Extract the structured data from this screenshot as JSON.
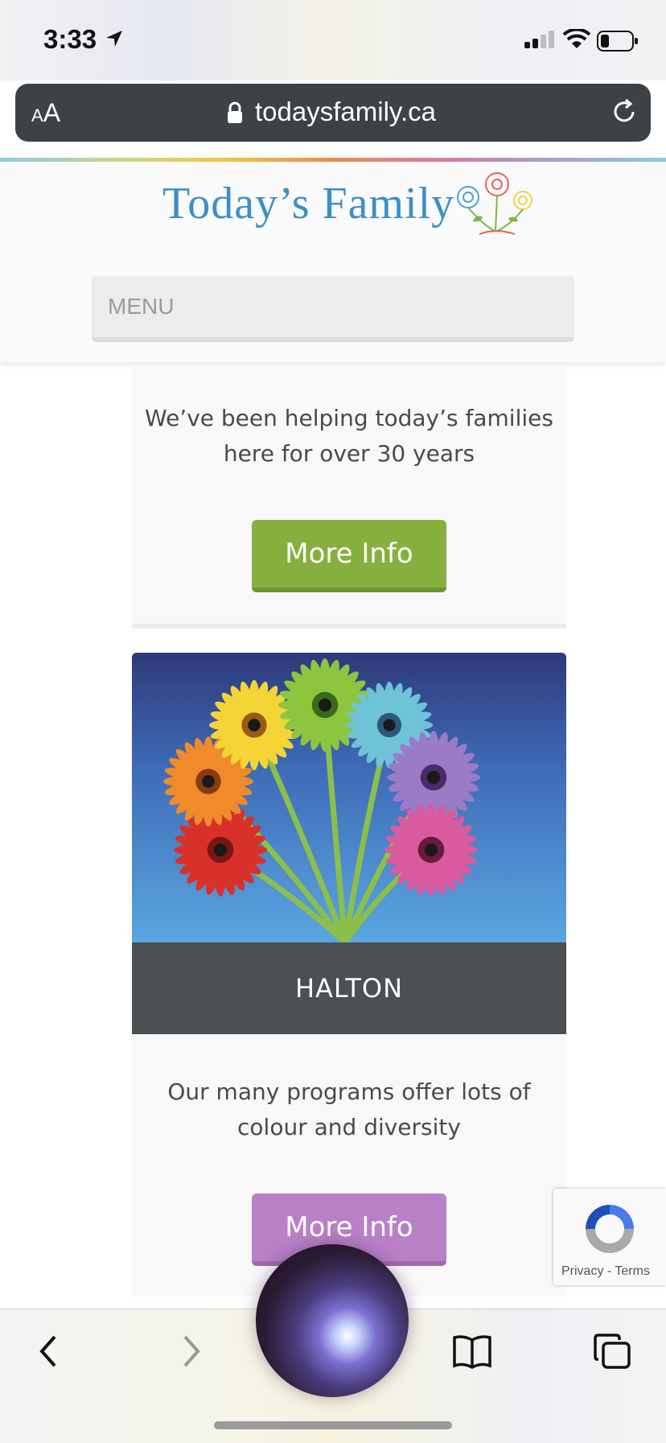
{
  "status": {
    "time": "3:33"
  },
  "browser": {
    "text_size_small": "A",
    "text_size_big": "A",
    "url": "todaysfamily.ca"
  },
  "header": {
    "logo_text": "Today’s Family",
    "menu_label": "MENU"
  },
  "cards": [
    {
      "text": "We’ve been helping today’s families here for over 30 years",
      "button_label": "More Info",
      "button_color": "#86b03e"
    },
    {
      "label": "HALTON",
      "text": "Our many programs offer lots of colour and diversity",
      "button_label": "More Info",
      "button_color": "#b980c8"
    }
  ],
  "recaptcha": {
    "privacy": "Privacy",
    "separator": "-",
    "terms": "Terms"
  },
  "toolbar": {
    "icons": [
      "back-icon",
      "forward-icon",
      "share-icon",
      "bookmarks-icon",
      "tabs-icon"
    ]
  },
  "colors": {
    "accent_blue": "#3d8fc7",
    "header_dark": "#4b5053",
    "url_bar": "#3d4246"
  }
}
